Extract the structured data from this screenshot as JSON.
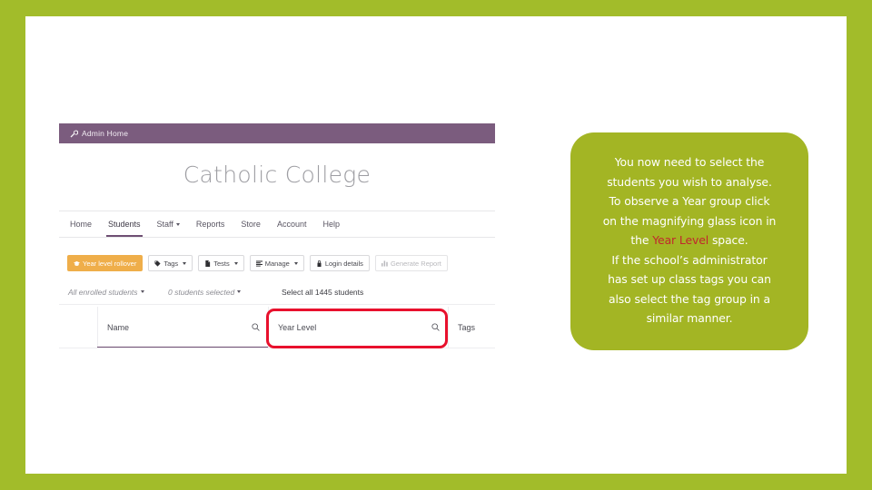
{
  "slide": {
    "border_color": "#A2BC2A",
    "background_color": "#FFFFFF"
  },
  "app_screenshot": {
    "admin_bar": {
      "icon": "wrench-icon",
      "label": "Admin Home",
      "background_color": "#7B5C7E"
    },
    "school_title": "Catholic College",
    "nav": {
      "items": [
        {
          "label": "Home",
          "active": false,
          "has_caret": false
        },
        {
          "label": "Students",
          "active": true,
          "has_caret": false
        },
        {
          "label": "Staff",
          "active": false,
          "has_caret": true
        },
        {
          "label": "Reports",
          "active": false,
          "has_caret": false
        },
        {
          "label": "Store",
          "active": false,
          "has_caret": false
        },
        {
          "label": "Account",
          "active": false,
          "has_caret": false
        },
        {
          "label": "Help",
          "active": false,
          "has_caret": false
        }
      ],
      "active_underline_color": "#6F4F73"
    },
    "toolbar": {
      "buttons": [
        {
          "label": "Year level rollover",
          "icon": "graduation-cap-icon",
          "style": "primary",
          "has_caret": false
        },
        {
          "label": "Tags",
          "icon": "tag-icon",
          "style": "default",
          "has_caret": true
        },
        {
          "label": "Tests",
          "icon": "file-icon",
          "style": "default",
          "has_caret": true
        },
        {
          "label": "Manage",
          "icon": "list-icon",
          "style": "default",
          "has_caret": true
        },
        {
          "label": "Login details",
          "icon": "lock-icon",
          "style": "default",
          "has_caret": false
        },
        {
          "label": "Generate Report",
          "icon": "bar-chart-icon",
          "style": "disabled",
          "has_caret": false
        }
      ],
      "primary_color": "#EFAE4A"
    },
    "filter_bar": {
      "enrolment_filter": "All enrolled students",
      "selection_count": "0 students selected",
      "select_all_link": "Select all 1445 students"
    },
    "table": {
      "columns": [
        {
          "label": "Name",
          "has_search": true
        },
        {
          "label": "Year Level",
          "has_search": true
        },
        {
          "label": "Tags",
          "has_search": false
        }
      ]
    },
    "highlight": {
      "target": "Year Level",
      "color": "#E8112D"
    }
  },
  "callout": {
    "background_color": "#A3B524",
    "text_color": "#FFFFFF",
    "highlight_color": "#C1272D",
    "line1": "You now need to select the",
    "line2": "students you wish to analyse.",
    "line3": "To observe a Year group click",
    "line4": "on the magnifying glass icon in",
    "line5_prefix": "the ",
    "line5_highlight": "Year Level",
    "line5_suffix": " space.",
    "line6": "If the school’s administrator",
    "line7": "has set up class tags you can",
    "line8": "also select the tag group in a",
    "line9": "similar manner."
  }
}
